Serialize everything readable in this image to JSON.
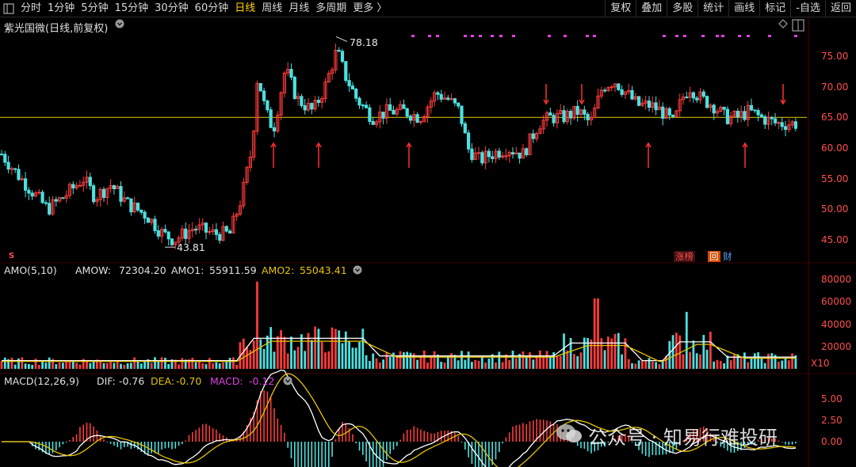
{
  "toolbar": {
    "periods": [
      "分时",
      "1分钟",
      "5分钟",
      "15分钟",
      "30分钟",
      "60分钟",
      "日线",
      "周线",
      "月线",
      "多周期",
      "更多 〉"
    ],
    "active_period": "日线",
    "actions": [
      "复权",
      "叠加",
      "多股",
      "统计",
      "画线",
      "标记",
      "-自选",
      "返回"
    ]
  },
  "price_panel": {
    "title": "紫光国微(日线,前复权)",
    "high_label": "78.18",
    "low_label": "43.81",
    "axis_ticks": [
      "75.00",
      "70.00",
      "65.00",
      "60.00",
      "55.00",
      "50.00",
      "45.00"
    ],
    "badges": {
      "zhangbang": "涨榜",
      "hui": "回",
      "cai": "财"
    },
    "s_marker": "S"
  },
  "amo_panel": {
    "title": "AMO(5,10)",
    "amow_label": "AMOW:",
    "amow_value": "72304.20",
    "amo1_label": "AMO1:",
    "amo1_value": "55911.59",
    "amo2_label": "AMO2:",
    "amo2_value": "55043.41",
    "axis_ticks": [
      "80000",
      "60000",
      "40000",
      "20000"
    ],
    "unit": "X10"
  },
  "macd_panel": {
    "title": "MACD(12,26,9)",
    "dif_label": "DIF:",
    "dif_value": "-0.76",
    "dea_label": "DEA:",
    "dea_value": "-0.70",
    "macd_label": "MACD:",
    "macd_value": "-0.12",
    "axis_ticks": [
      "5.00",
      "2.50",
      "0.00"
    ]
  },
  "watermark": "公众号 · 知易行难投研",
  "colors": {
    "up": "#ff3b3b",
    "down": "#4ce0e0",
    "ma_white": "#ffffff",
    "ma_yellow": "#e6c300",
    "line_yellow": "#c8b400",
    "magenta": "#e040e0"
  },
  "chart_data": {
    "type": "candlestick",
    "price_range": [
      43.81,
      78.18
    ],
    "reference_line": 65.0
  }
}
